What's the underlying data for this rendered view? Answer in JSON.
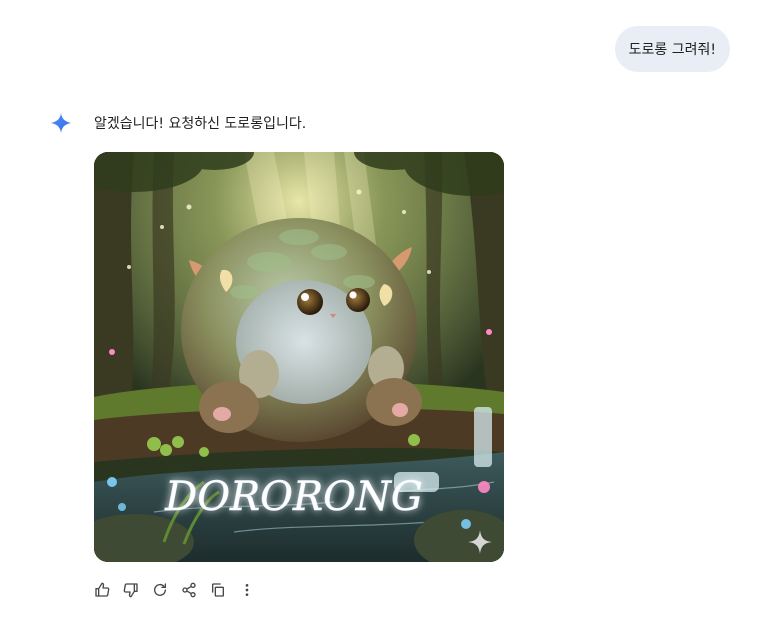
{
  "user_message": "도로롱 그려줘!",
  "model_reply": "알겠습니다! 요청하신 도로롱입니다.",
  "image": {
    "caption_text": "DORORONG",
    "accent": "#1a73e8"
  },
  "action_icons": [
    "thumb-up-icon",
    "thumb-down-icon",
    "regenerate-icon",
    "share-icon",
    "copy-icon",
    "more-vert-icon"
  ],
  "colors": {
    "user_bubble": "#e9eef6",
    "spark_blue": "#4285f4"
  }
}
